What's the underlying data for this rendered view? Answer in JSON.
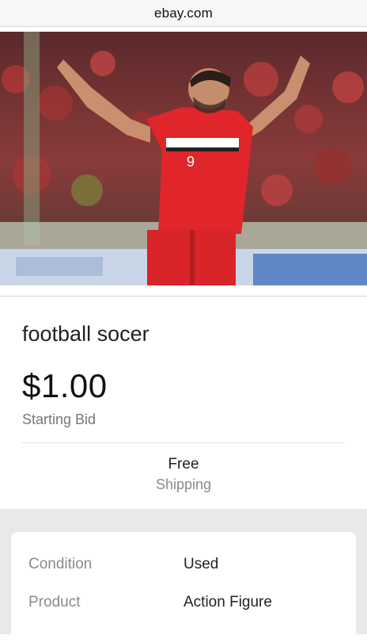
{
  "browser": {
    "url": "ebay.com"
  },
  "listing": {
    "title": "football socer",
    "price": "$1.00",
    "price_label": "Starting Bid",
    "shipping_line1": "Free",
    "shipping_line2": "Shipping"
  },
  "specs": [
    {
      "key": "Condition",
      "value": "Used"
    },
    {
      "key": "Product",
      "value": "Action Figure"
    }
  ],
  "jersey_number": "9"
}
